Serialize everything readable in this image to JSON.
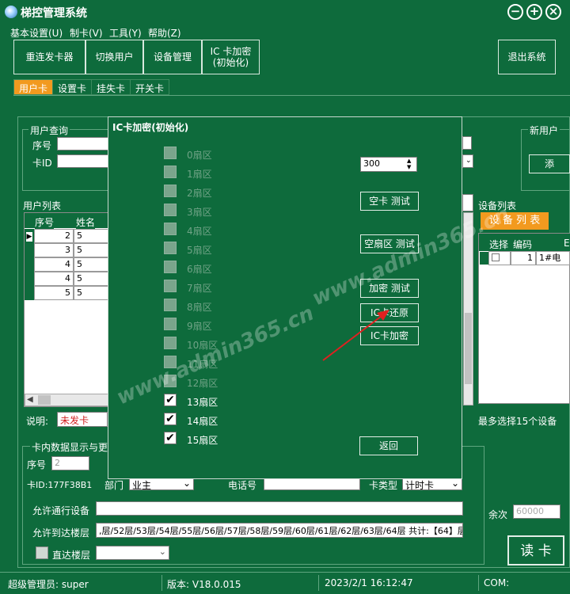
{
  "app": {
    "title": "梯控管理系统"
  },
  "window_controls": {
    "minimize": "−",
    "maximize": "+",
    "close": "×"
  },
  "menu": [
    "基本设置(U)",
    "制卡(V)",
    "工具(Y)",
    "帮助(Z)"
  ],
  "toolbar": {
    "buttons": [
      "重连发卡器",
      "切换用户",
      "设备管理",
      "IC 卡加密\n(初始化)"
    ],
    "exit": "退出系统"
  },
  "tabs": [
    "用户卡",
    "设置卡",
    "挂失卡",
    "开关卡"
  ],
  "user_query": {
    "title": "用户查询",
    "seq_label": "序号",
    "card_id_label": "卡ID"
  },
  "new_user_title": "新用户",
  "new_user_btn": "添",
  "user_list": {
    "title": "用户列表",
    "columns": [
      "序号",
      "姓名"
    ],
    "rows": [
      [
        "2",
        "5"
      ],
      [
        "3",
        "5"
      ],
      [
        "4",
        "5"
      ],
      [
        "4",
        "5"
      ],
      [
        "5",
        "5"
      ]
    ]
  },
  "device_list": {
    "title": "设备列表",
    "button": "设 备 列 表",
    "columns": [
      "选择",
      "编码",
      "E"
    ],
    "rows": [
      [
        "",
        "1",
        "1#电"
      ]
    ],
    "max_note": "最多选择15个设备"
  },
  "explain": {
    "label": "说明:",
    "value": "未发卡"
  },
  "card_data": {
    "title": "卡内数据显示与更",
    "seq_label": "序号",
    "seq_value": "2",
    "card_id": "卡ID:177F38B1",
    "dept_label": "部门",
    "dept_value": "业主",
    "phone_label": "电话号",
    "card_type_label": "卡类型",
    "card_type_value": "计时卡",
    "allow_device_label": "允许通行设备",
    "allow_floor_label": "允许到达楼层",
    "allow_floor_value": ",层/52层/53层/54层/55层/56层/57层/58层/59层/60层/61层/62层/63层/64层  共计:【64】层",
    "direct_floor_label": "直达楼层",
    "balance_label": "余次",
    "balance_placeholder": "60000",
    "read_card": "读 卡"
  },
  "dialog": {
    "title": "IC卡加密(初始化)",
    "sectors": [
      {
        "label": "0扇区",
        "checked": false
      },
      {
        "label": "1扇区",
        "checked": false
      },
      {
        "label": "2扇区",
        "checked": false
      },
      {
        "label": "3扇区",
        "checked": false
      },
      {
        "label": "4扇区",
        "checked": false
      },
      {
        "label": "5扇区",
        "checked": false
      },
      {
        "label": "6扇区",
        "checked": false
      },
      {
        "label": "7扇区",
        "checked": false
      },
      {
        "label": "8扇区",
        "checked": false
      },
      {
        "label": "9扇区",
        "checked": false
      },
      {
        "label": "10扇区",
        "checked": false
      },
      {
        "label": "11扇区",
        "checked": false
      },
      {
        "label": "12扇区",
        "checked": false
      },
      {
        "label": "13扇区",
        "checked": true
      },
      {
        "label": "14扇区",
        "checked": true
      },
      {
        "label": "15扇区",
        "checked": true
      }
    ],
    "spin_value": "300",
    "buttons": {
      "empty_card_test": "空卡 测试",
      "empty_sector_test": "空扇区 测试",
      "encrypt_test": "加密 测试",
      "ic_restore": "IC卡还原",
      "ic_encrypt": "IC卡加密",
      "back": "返回"
    }
  },
  "watermark": "www.admin365.cn",
  "status": {
    "user": "超级管理员: super",
    "version": "版本: V18.0.015",
    "datetime": "2023/2/1 16:12:47",
    "com": "COM:"
  },
  "colors": {
    "background": "#0e6b3c",
    "accent_orange": "#f29a1f",
    "annotation_arrow": "#e02020"
  },
  "icons": [
    "app-icon",
    "minimize-icon",
    "maximize-icon",
    "close-icon",
    "spin-up-icon",
    "spin-down-icon",
    "dropdown-icon",
    "row-pointer-icon",
    "checkmark-icon"
  ]
}
